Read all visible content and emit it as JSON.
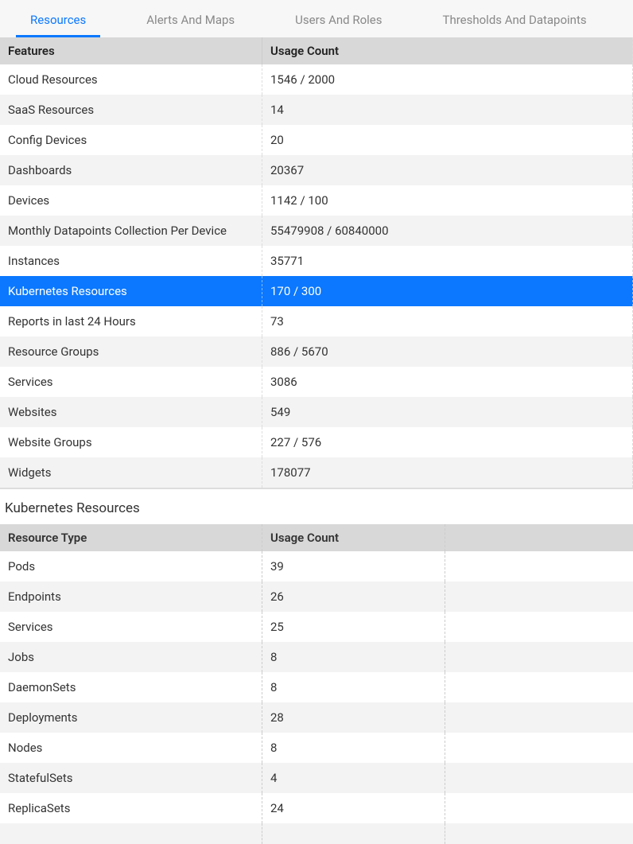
{
  "tabs": {
    "resources": "Resources",
    "alerts": "Alerts And Maps",
    "users": "Users And Roles",
    "thresholds": "Thresholds And Datapoints"
  },
  "columns": {
    "features": "Features",
    "usage": "Usage Count"
  },
  "rows": {
    "cloud": {
      "label": "Cloud Resources",
      "value": "1546 / 2000"
    },
    "saas": {
      "label": "SaaS Resources",
      "value": "14"
    },
    "config": {
      "label": "Config Devices",
      "value": "20"
    },
    "dash": {
      "label": "Dashboards",
      "value": "20367"
    },
    "devices": {
      "label": "Devices",
      "value": "1142 / 100"
    },
    "monthly": {
      "label": "Monthly Datapoints Collection Per Device",
      "value": "55479908 / 60840000"
    },
    "inst": {
      "label": "Instances",
      "value": "35771"
    },
    "k8s": {
      "label": "Kubernetes Resources",
      "value": "170 / 300"
    },
    "reports": {
      "label": "Reports in last 24 Hours",
      "value": "73"
    },
    "rgroups": {
      "label": "Resource Groups",
      "value": "886 / 5670"
    },
    "services": {
      "label": "Services",
      "value": "3086"
    },
    "websites": {
      "label": "Websites",
      "value": "549"
    },
    "wgroups": {
      "label": "Website Groups",
      "value": "227 / 576"
    },
    "widgets": {
      "label": "Widgets",
      "value": "178077"
    }
  },
  "detail": {
    "title": "Kubernetes Resources",
    "columns": {
      "type": "Resource Type",
      "usage": "Usage Count"
    },
    "rows": {
      "pods": {
        "label": "Pods",
        "value": "39"
      },
      "endpoints": {
        "label": "Endpoints",
        "value": "26"
      },
      "services": {
        "label": "Services",
        "value": "25"
      },
      "jobs": {
        "label": "Jobs",
        "value": "8"
      },
      "daemonsets": {
        "label": "DaemonSets",
        "value": "8"
      },
      "deploys": {
        "label": "Deployments",
        "value": "28"
      },
      "nodes": {
        "label": "Nodes",
        "value": "8"
      },
      "stateful": {
        "label": "StatefulSets",
        "value": "4"
      },
      "replica": {
        "label": "ReplicaSets",
        "value": "24"
      }
    }
  }
}
